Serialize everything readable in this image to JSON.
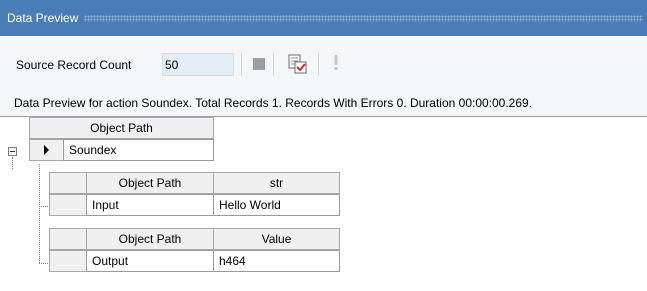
{
  "window": {
    "title": "Data Preview"
  },
  "toolbar": {
    "source_record_count_label": "Source Record Count",
    "source_record_count_value": "50",
    "icons": [
      "stop-icon",
      "preview-icon",
      "warning-icon"
    ]
  },
  "status": {
    "message": "Data Preview for action Soundex. Total Records 1. Records With Errors 0. Duration 00:00:00.269."
  },
  "grid": {
    "header": "Object Path",
    "root_value": "Soundex",
    "children": [
      {
        "header_path": "Object Path",
        "header_value": "str",
        "path": "Input",
        "value": "Hello World"
      },
      {
        "header_path": "Object Path",
        "header_value": "Value",
        "path": "Output",
        "value": "h464"
      }
    ]
  },
  "colors": {
    "titlebar": "#4a7db5",
    "toolbar_bg": "#f5f6f7",
    "count_field_bg": "#e4ecf6",
    "header_bg": "#f0f0f0",
    "icon_check_red": "#d42a2a"
  }
}
